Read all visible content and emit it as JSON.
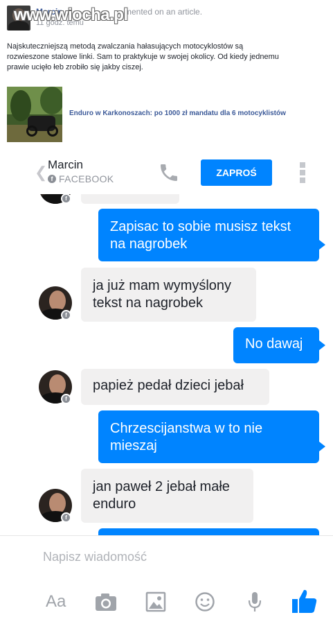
{
  "watermark": "www.wiocha.pl",
  "notification": {
    "author": "Marcin",
    "action": "...mented on an article.",
    "time": "11 godz. temu",
    "text": "Najskuteczniejszą metodą zwalczania hałasujących motocyklostów są rozwieszone stalowe linki. Sam to praktykuje w swojej okolicy. Od kiedy jednemu prawie ucięło łeb zrobiło się jakby ciszej.",
    "article_title": "Enduro w Karkonoszach: po 1000 zł mandatu dla 6 motocyklistów"
  },
  "header": {
    "contact_name": "Marcin",
    "source_label": "FACEBOOK",
    "invite_label": "ZAPROŚ"
  },
  "messages": [
    {
      "dir": "out",
      "text": "Zapisac to sobie musisz tekst na nagrobek"
    },
    {
      "dir": "in",
      "text": "ja już mam wymyślony tekst na nagrobek"
    },
    {
      "dir": "out",
      "text": "No dawaj"
    },
    {
      "dir": "in",
      "text": "papież pedał dzieci jebał"
    },
    {
      "dir": "out",
      "text": "Chrzescijanstwa w to nie mieszaj"
    },
    {
      "dir": "in",
      "text": "jan paweł 2 jebał małe enduro"
    }
  ],
  "composer": {
    "placeholder": "Napisz wiadomość",
    "aa_label": "Aa"
  },
  "colors": {
    "messenger_blue": "#0084ff",
    "incoming_bubble": "#f1f0f0",
    "facebook_link": "#3b5998"
  },
  "icons": [
    "chevron-left-icon",
    "facebook-icon",
    "phone-icon",
    "more-vert-icon",
    "camera-icon",
    "image-icon",
    "emoji-icon",
    "microphone-icon",
    "thumbs-up-icon"
  ]
}
